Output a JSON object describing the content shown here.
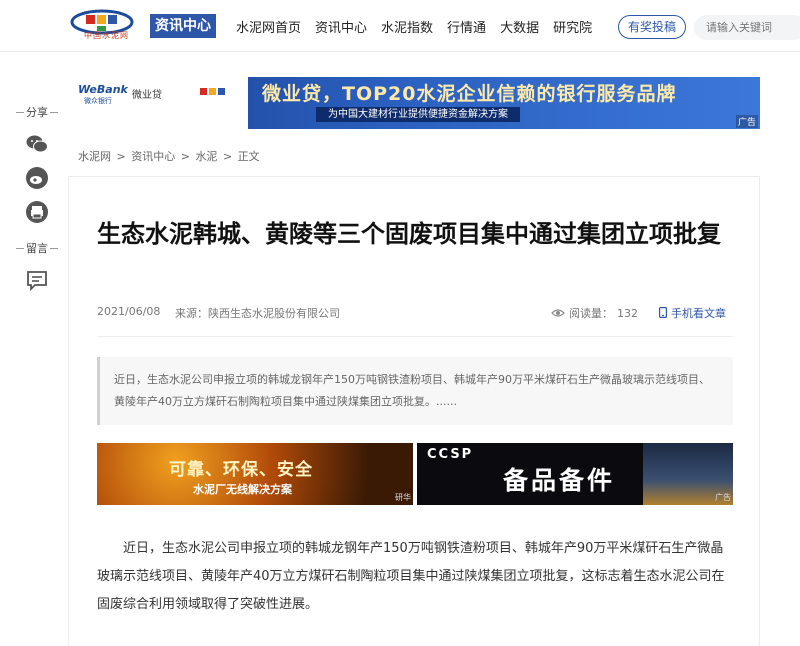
{
  "header": {
    "logo_text": "中国水泥网",
    "logo_sub": "Ccement.com",
    "section_badge": "资讯中心",
    "nav": [
      "水泥网首页",
      "资讯中心",
      "水泥指数",
      "行情通",
      "大数据",
      "研究院"
    ],
    "post_button": "有奖投稿",
    "search_placeholder": "请输入关键词"
  },
  "banner": {
    "brand": "WeBank",
    "brand_sub": "微众银行",
    "product": "微业贷",
    "title": "微业贷，TOP20水泥企业信赖的银行服务品牌",
    "subtitle": "为中国大建材行业提供便捷资金解决方案",
    "ad_tag": "广告"
  },
  "share_rail": {
    "share_label": "分享",
    "comment_label": "留言",
    "icons": [
      "wechat-icon",
      "weibo-icon",
      "print-icon",
      "comment-icon"
    ]
  },
  "breadcrumb": [
    "水泥网",
    ">",
    "资讯中心",
    ">",
    "水泥",
    ">",
    "正文"
  ],
  "article": {
    "title": "生态水泥韩城、黄陵等三个固废项目集中通过集团立项批复",
    "date": "2021/06/08",
    "source": "来源：陕西生态水泥股份有限公司",
    "reads_label": "阅读量：",
    "reads_count": "132",
    "mobile_link": "手机看文章",
    "summary": "近日，生态水泥公司申报立项的韩城龙钢年产150万吨钢铁渣粉项目、韩城年产90万平米煤矸石生产微晶玻璃示范线项目、黄陵年产40万立方煤矸石制陶粒项目集中通过陕煤集团立项批复。......",
    "body": "近日，生态水泥公司申报立项的韩城龙钢年产150万吨钢铁渣粉项目、韩城年产90万平米煤矸石生产微晶玻璃示范线项目、黄陵年产40万立方煤矸石制陶粒项目集中通过陕煤集团立项批复，这标志着生态水泥公司在固废综合利用领域取得了突破性进展。"
  },
  "ads": {
    "ad1_title": "可靠、环保、安全",
    "ad1_sub": "水泥厂无线解决方案",
    "ad1_brand": "研华",
    "ad2_brand": "CCSP",
    "ad2_title": "备品备件",
    "ad2_tag": "广告"
  },
  "colors": {
    "brand_blue": "#2e57a9",
    "logo_red": "#c23b22"
  }
}
